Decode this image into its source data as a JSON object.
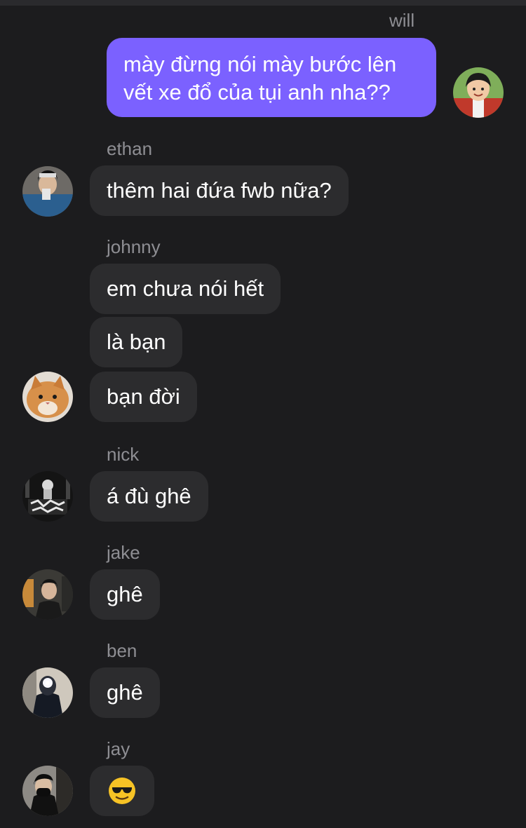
{
  "messages": [
    {
      "sender": "will",
      "text": "mày đừng nói mày bước lên vết xe đổ của tụi anh nha??"
    },
    {
      "sender": "ethan",
      "text": "thêm hai đứa fwb nữa?"
    },
    {
      "sender": "johnny",
      "texts": [
        "em chưa nói hết",
        "là bạn",
        "bạn đời"
      ]
    },
    {
      "sender": "nick",
      "text": "á đù ghê"
    },
    {
      "sender": "jake",
      "text": "ghê"
    },
    {
      "sender": "ben",
      "text": "ghê"
    },
    {
      "sender": "jay",
      "emoji": "sunglasses-emoji"
    }
  ],
  "colors": {
    "background": "#1c1c1e",
    "incoming_bubble": "#2c2c2e",
    "outgoing_bubble": "#7b61ff",
    "sender_name": "#8e8e93"
  }
}
